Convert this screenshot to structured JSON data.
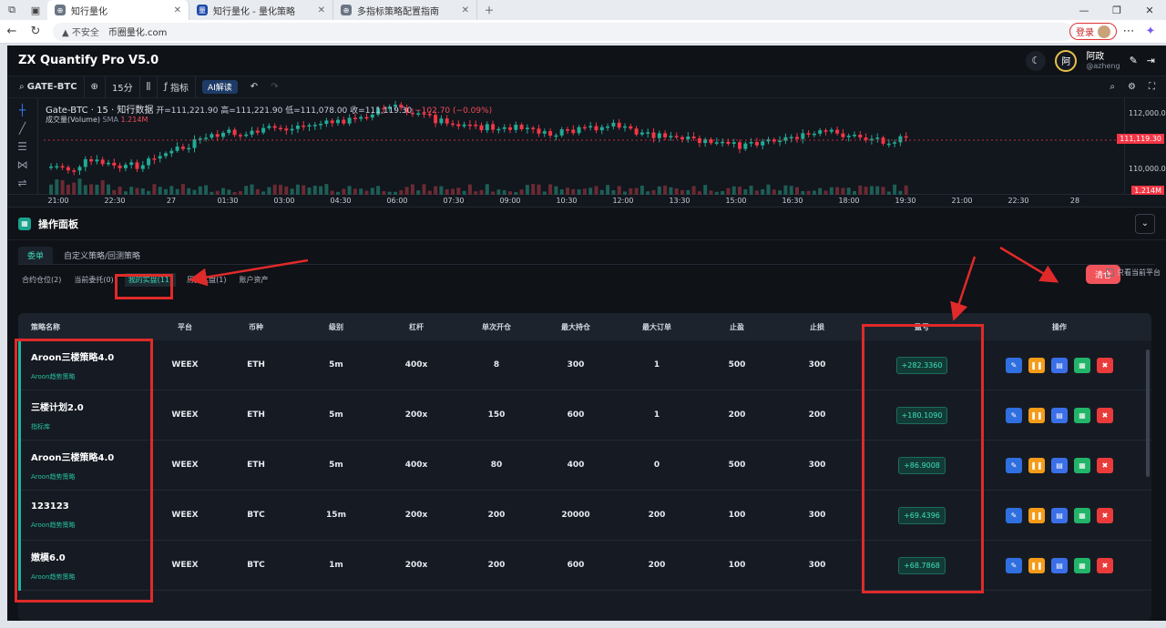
{
  "browser": {
    "tabs": [
      {
        "label": "知行量化",
        "active": true
      },
      {
        "label": "知行量化 - 量化策略",
        "active": false
      },
      {
        "label": "多指标策略配置指南",
        "active": false
      }
    ],
    "insecure_label": "不安全",
    "url": "币圈量化.com",
    "login_label": "登录"
  },
  "app": {
    "title": "ZX Quantify Pro V5.0",
    "user_avatar_char": "阿",
    "user_name": "阿政",
    "user_handle": "@azheng"
  },
  "toolbar": {
    "symbol": "GATE-BTC",
    "interval": "15分",
    "indicator_label": "指标",
    "ai_label": "AI解读"
  },
  "chart": {
    "legend_title": "Gate-BTC · 15 · 知行数据",
    "open_label": "开",
    "open": "=111,221.90",
    "high_label": "高",
    "high": "=111,221.90",
    "low_label": "低",
    "low": "=111,078.00",
    "close_label": "收",
    "close": "=111,119.30",
    "change": "−102.70 (−0.09%)",
    "volume_label": "成交量(Volume)",
    "volume_ma": "SMA",
    "volume_value": "1.214M",
    "y_ticks": [
      "112,000.00",
      "110,000.00"
    ],
    "last_price": "111,119.30",
    "last_volume": "1.214M",
    "x_ticks": [
      "21:00",
      "22:30",
      "27",
      "01:30",
      "03:00",
      "04:30",
      "06:00",
      "07:30",
      "09:00",
      "10:30",
      "12:00",
      "13:30",
      "15:00",
      "16:30",
      "18:00",
      "19:30",
      "21:00",
      "22:30",
      "28"
    ]
  },
  "panel": {
    "title": "操作面板",
    "tabs": [
      {
        "label": "委单",
        "active": true
      },
      {
        "label": "自定义策略/回测策略",
        "active": false
      }
    ],
    "subtabs": [
      {
        "label": "合约仓位(2)",
        "active": false
      },
      {
        "label": "当前委托(0)",
        "active": false
      },
      {
        "label": "我的实盘(11)",
        "active": true
      },
      {
        "label": "历史实盘(1)",
        "active": false
      },
      {
        "label": "账户资产",
        "active": false
      }
    ],
    "close_all_label": "清仓",
    "only_current_label": "只看当前平台"
  },
  "table": {
    "headers": [
      "策略名称",
      "平台",
      "币种",
      "级别",
      "杠杆",
      "单次开仓",
      "最大持仓",
      "最大订单",
      "止盈",
      "止损",
      "盈亏",
      "操作"
    ],
    "rows": [
      {
        "name": "Aroon三楼策略4.0",
        "tag": "Aroon趋势策略",
        "platform": "WEEX",
        "coin": "ETH",
        "level": "5m",
        "leverage": "400x",
        "open": "8",
        "max_pos": "300",
        "max_order": "1",
        "tp": "500",
        "sl": "300",
        "pnl": "+282.3360"
      },
      {
        "name": "三楼计划2.0",
        "tag": "指标库",
        "platform": "WEEX",
        "coin": "ETH",
        "level": "5m",
        "leverage": "200x",
        "open": "150",
        "max_pos": "600",
        "max_order": "1",
        "tp": "200",
        "sl": "200",
        "pnl": "+180.1090"
      },
      {
        "name": "Aroon三楼策略4.0",
        "tag": "Aroon趋势策略",
        "platform": "WEEX",
        "coin": "ETH",
        "level": "5m",
        "leverage": "400x",
        "open": "80",
        "max_pos": "400",
        "max_order": "0",
        "tp": "500",
        "sl": "300",
        "pnl": "+86.9008"
      },
      {
        "name": "123123",
        "tag": "Aroon趋势策略",
        "platform": "WEEX",
        "coin": "BTC",
        "level": "15m",
        "leverage": "200x",
        "open": "200",
        "max_pos": "20000",
        "max_order": "200",
        "tp": "100",
        "sl": "300",
        "pnl": "+69.4396"
      },
      {
        "name": "嫩模6.0",
        "tag": "Aroon趋势策略",
        "platform": "WEEX",
        "coin": "BTC",
        "level": "1m",
        "leverage": "200x",
        "open": "200",
        "max_pos": "600",
        "max_order": "200",
        "tp": "100",
        "sl": "300",
        "pnl": "+68.7868"
      }
    ],
    "colors": {
      "edit": "#2f6fe0",
      "pause": "#f59c1a",
      "doc": "#3b6fe8",
      "log": "#22b56a",
      "delete": "#ea3b3b"
    }
  }
}
